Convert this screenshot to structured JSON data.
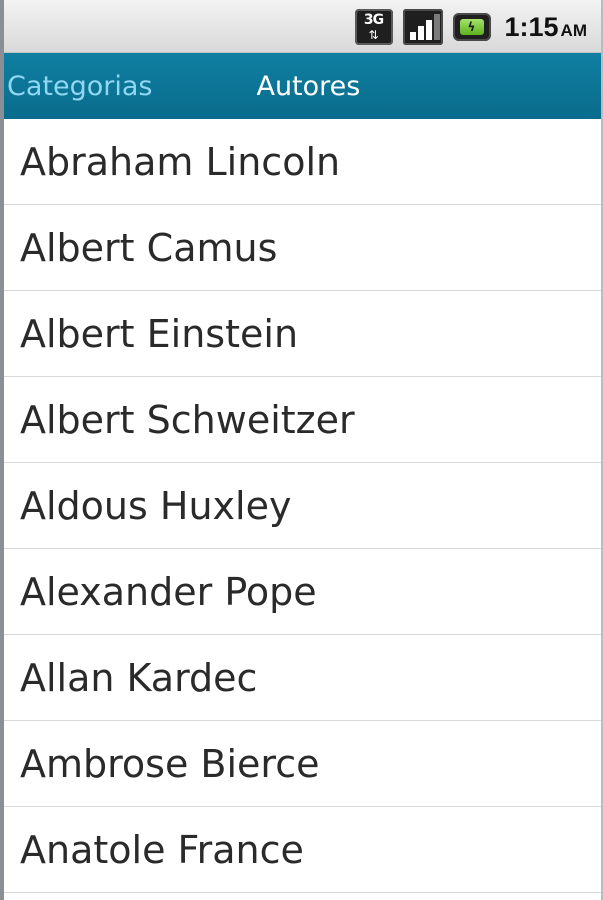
{
  "status_bar": {
    "network_type": "3G",
    "data_arrows": "⇅",
    "battery_glyph": "ϟ",
    "time": "1:15",
    "ampm": "AM",
    "icons": [
      "3g-icon",
      "signal-icon",
      "battery-icon"
    ]
  },
  "tabs": [
    {
      "label": "Categorias",
      "selected": false
    },
    {
      "label": "Autores",
      "selected": true
    }
  ],
  "authors": [
    "Abraham Lincoln",
    "Albert Camus",
    "Albert Einstein",
    "Albert Schweitzer",
    "Aldous Huxley",
    "Alexander Pope",
    "Allan Kardec",
    "Ambrose Bierce",
    "Anatole France"
  ],
  "colors": {
    "tab_bar_bg": "#0e7b9e",
    "tab_selected": "#ffffff",
    "tab_unselected": "#8fd7f3",
    "list_text": "#2a2a2a",
    "divider": "#d7d7d7"
  }
}
